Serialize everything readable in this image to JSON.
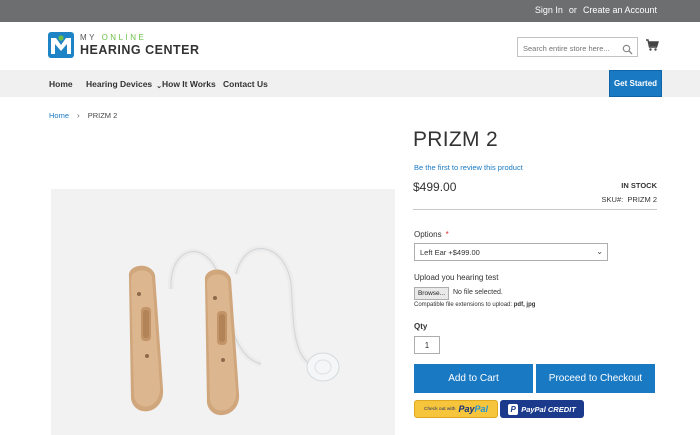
{
  "topbar": {
    "signin": "Sign In",
    "or": "or",
    "create_account": "Create an Account"
  },
  "logo": {
    "line1_a": "MY ",
    "line1_b": "ONLINE",
    "line2": "HEARING CENTER"
  },
  "search": {
    "placeholder": "Search entire store here..."
  },
  "nav": {
    "home": "Home",
    "devices": "Hearing Devices",
    "how": "How It Works",
    "contact": "Contact Us",
    "cta": "Get Started"
  },
  "breadcrumb": {
    "home": "Home",
    "current": "PRIZM 2"
  },
  "product": {
    "title": "PRIZM 2",
    "review_link": "Be the first to review this product",
    "price": "$499.00",
    "stock": "IN STOCK",
    "sku_label": "SKU#:",
    "sku": "PRIZM 2",
    "options_label": "Options",
    "required_mark": "*",
    "option_selected": "Left Ear +$499.00",
    "upload_label": "Upload you hearing test",
    "browse_label": "Browse...",
    "no_file": "No file selected.",
    "ext_prefix": "Compatible file extensions to upload: ",
    "ext_values": "pdf, jpg",
    "qty_label": "Qty",
    "qty_value": "1",
    "add_to_cart": "Add to Cart",
    "checkout": "Proceed to Checkout",
    "paypal_small": "Check out with",
    "paypal_pay": "Pay",
    "paypal_pal": "Pal",
    "paypal_credit": "PayPal CREDIT"
  },
  "colors": {
    "primary": "#1979c3",
    "topbar": "#6d6e70",
    "nav_bg": "#f0f0f0"
  },
  "icons": [
    "search-icon",
    "cart-icon",
    "chevron-down-icon",
    "logo-icon"
  ]
}
